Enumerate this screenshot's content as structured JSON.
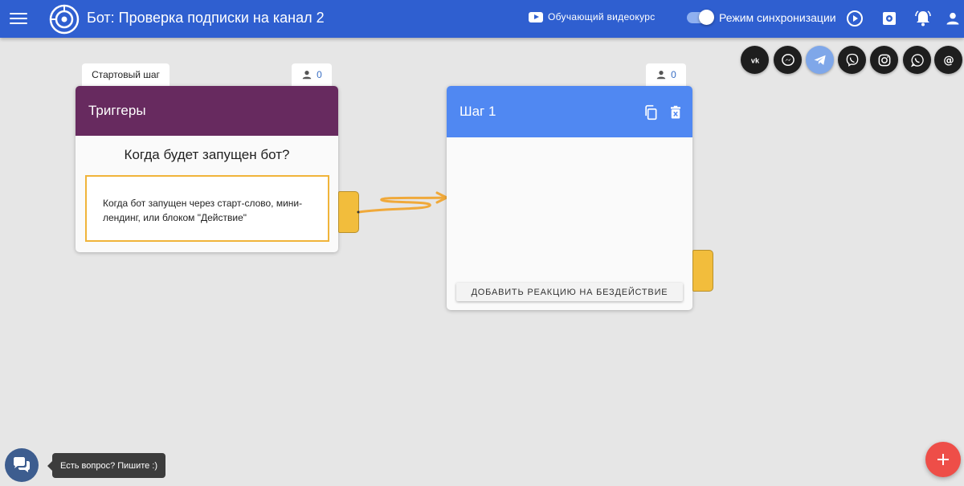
{
  "header": {
    "title": "Бот: Проверка подписки на канал 2",
    "course_label": "Обучающий видеокурс",
    "sync_label": "Режим синхронизации",
    "sync_enabled": true,
    "icons": [
      "menu-icon",
      "logo-icon",
      "youtube-icon",
      "toggle-switch",
      "play-icon",
      "settings-icon",
      "bell-icon",
      "user-icon"
    ]
  },
  "social": {
    "items": [
      "vk-icon",
      "messenger-icon",
      "telegram-icon",
      "viber-icon",
      "instagram-icon",
      "whatsapp-icon",
      "email-icon"
    ],
    "active": "telegram-icon"
  },
  "trigger_card": {
    "tag": "Стартовый шаг",
    "users_count": "0",
    "title": "Триггеры",
    "question": "Когда будет запущен бот?",
    "trigger_text": "Когда бот запущен через старт-слово, мини-лендинг, или блоком \"Действие\""
  },
  "step_card": {
    "users_count": "0",
    "title": "Шаг 1",
    "add_button": "ДОБАВИТЬ РЕАКЦИЮ НА БЕЗДЕЙСТВИЕ"
  },
  "colors": {
    "header": "#2f5fd0",
    "trigger_header": "#672a5f",
    "step_header": "#5088f2",
    "handle": "#f2bd3c",
    "connector": "#f0a93a",
    "fab": "#ee4e48"
  },
  "chat": {
    "tooltip": "Есть вопрос? Пишите :)"
  }
}
